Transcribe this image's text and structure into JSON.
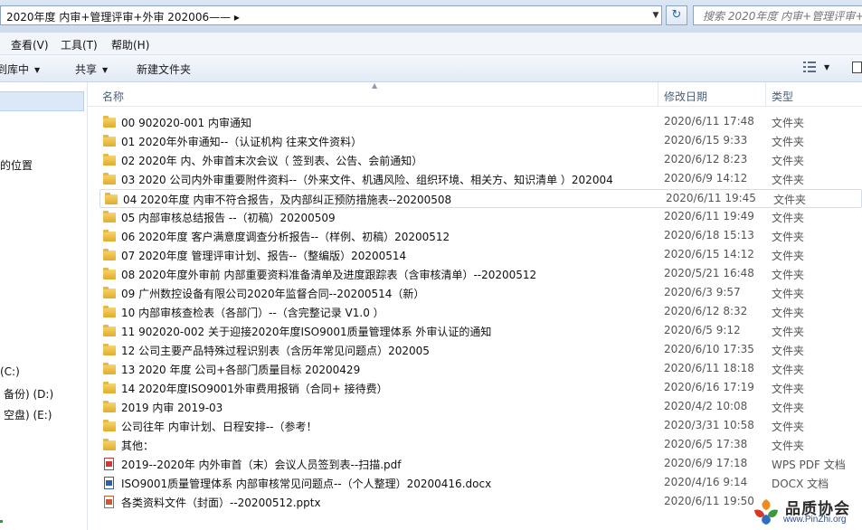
{
  "address": {
    "path": "2020年度 内审+管理评审+外审  202006——  ▸",
    "search_placeholder": "搜索 2020年度 内审+管理评审+..."
  },
  "menu": [
    "查看(V)",
    "工具(T)",
    "帮助(H)"
  ],
  "toolbar": {
    "include_library": "添加到库中",
    "share": "共享",
    "new_folder": "新建文件夹"
  },
  "nav": {
    "items": [
      "的位置",
      "(C:)",
      "备份) (D:)",
      "空盘) (E:)"
    ]
  },
  "columns": {
    "name": "名称",
    "date": "修改日期",
    "type": "类型"
  },
  "files": [
    {
      "name": "00      902020-001 内审通知",
      "date": "2020/6/11 17:48",
      "type": "文件夹",
      "kind": "folder"
    },
    {
      "name": "01      2020年外审通知--（认证机构    往来文件资料）",
      "date": "2020/6/15 9:33",
      "type": "文件夹",
      "kind": "folder"
    },
    {
      "name": "02      2020年 内、外审首末次会议（ 签到表、公告、会前通知）",
      "date": "2020/6/12 8:23",
      "type": "文件夹",
      "kind": "folder"
    },
    {
      "name": "03       2020 公司内外审重要附件资料--（外来文件、机遇风险、组织环境、相关方、知识清单  ）202004",
      "date": "2020/6/9 14:12",
      "type": "文件夹",
      "kind": "folder"
    },
    {
      "name": "04      2020年度  内审不符合报告，及内部纠正预防措施表--20200508",
      "date": "2020/6/11 19:45",
      "type": "文件夹",
      "kind": "folder",
      "selected": true
    },
    {
      "name": "05      内部审核总结报告  --（初稿）20200509",
      "date": "2020/6/11 19:49",
      "type": "文件夹",
      "kind": "folder"
    },
    {
      "name": "06     2020年度 客户满意度调查分析报告--（样例、初稿）20200512",
      "date": "2020/6/18 15:13",
      "type": "文件夹",
      "kind": "folder"
    },
    {
      "name": "07      2020年度 管理评审计划、报告--（整编版）20200514",
      "date": "2020/6/15 14:12",
      "type": "文件夹",
      "kind": "folder"
    },
    {
      "name": "08      2020年度外审前 内部重要资料准备清单及进度跟踪表（含审核清单）--20200512",
      "date": "2020/5/21 16:48",
      "type": "文件夹",
      "kind": "folder"
    },
    {
      "name": "09     广州数控设备有限公司2020年监督合同--20200514（新）",
      "date": "2020/6/3 9:57",
      "type": "文件夹",
      "kind": "folder"
    },
    {
      "name": "10     内部审核查检表（各部门）--（含完整记录  V1.0 ）",
      "date": "2020/6/12 8:32",
      "type": "文件夹",
      "kind": "folder"
    },
    {
      "name": "11     902020-002 关于迎接2020年度ISO9001质量管理体系 外审认证的通知",
      "date": "2020/6/5 9:12",
      "type": "文件夹",
      "kind": "folder"
    },
    {
      "name": "12   公司主要产品特殊过程识别表（含历年常见问题点）202005",
      "date": "2020/6/10 17:35",
      "type": "文件夹",
      "kind": "folder"
    },
    {
      "name": "13      2020 年度 公司+各部门质量目标 20200429",
      "date": "2020/6/11 18:18",
      "type": "文件夹",
      "kind": "folder"
    },
    {
      "name": "14     2020年度ISO9001外审费用报销（合同+ 接待费）",
      "date": "2020/6/16 17:19",
      "type": "文件夹",
      "kind": "folder"
    },
    {
      "name": "2019 内审 2019-03",
      "date": "2020/4/2 10:08",
      "type": "文件夹",
      "kind": "folder"
    },
    {
      "name": "公司往年 内审计划、日程安排--（参考！",
      "date": "2020/3/31 10:58",
      "type": "文件夹",
      "kind": "folder"
    },
    {
      "name": "其他：",
      "date": "2020/6/5 17:38",
      "type": "文件夹",
      "kind": "folder"
    },
    {
      "name": "2019--2020年 内外审首（末）会议人员签到表--扫描.pdf",
      "date": "2020/6/9 17:18",
      "type": "WPS PDF 文档",
      "kind": "pdf"
    },
    {
      "name": "ISO9001质量管理体系 内部审核常见问题点--（个人整理）20200416.docx",
      "date": "2020/4/16 9:14",
      "type": "DOCX 文档",
      "kind": "doc"
    },
    {
      "name": "各类资料文件（封面）--20200512.pptx",
      "date": "2020/6/11 19:50",
      "type": "",
      "kind": "ppt"
    }
  ],
  "watermark": {
    "title": "品质协会",
    "url": "www.PinZhi.org"
  }
}
